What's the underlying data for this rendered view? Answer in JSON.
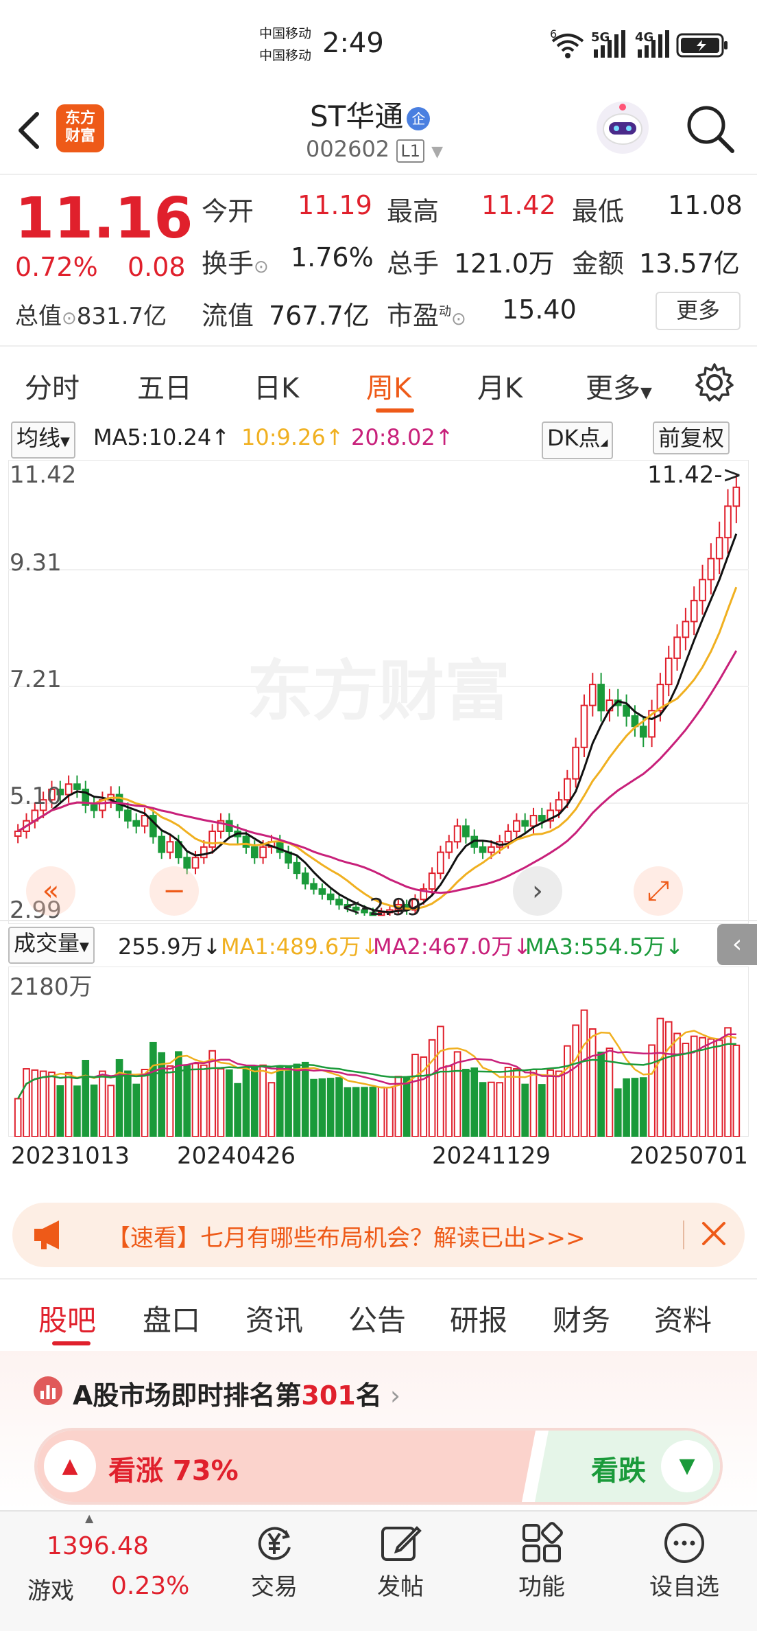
{
  "status_bar": {
    "carrier1": "中国移动",
    "carrier2": "中国移动",
    "time": "2:49",
    "net1": "6",
    "net2": "5G",
    "net3": "4G"
  },
  "header": {
    "logo_line1": "东方",
    "logo_line2": "财富",
    "title": "ST华通",
    "badge": "企",
    "code": "002602",
    "level": "L1"
  },
  "quote": {
    "price": "11.16",
    "change_pct": "0.72%",
    "change": "0.08",
    "total_value_label": "总值",
    "total_value": "831.7亿",
    "open_label": "今开",
    "open": "11.19",
    "high_label": "最高",
    "high": "11.42",
    "low_label": "最低",
    "low": "11.08",
    "turnover_label": "换手",
    "turnover": "1.76%",
    "volume_label": "总手",
    "volume": "121.0万",
    "amount_label": "金额",
    "amount": "13.57亿",
    "float_label": "流值",
    "float_value": "767.7亿",
    "pe_label": "市盈",
    "pe_sup": "动",
    "pe": "15.40",
    "more_label": "更多"
  },
  "tabs": {
    "items": [
      "分时",
      "五日",
      "日K",
      "周K",
      "月K",
      "更多"
    ],
    "active": "周K"
  },
  "kchart": {
    "ma_select": "均线",
    "ma5": "MA5:10.24↑",
    "ma10": "10:9.26↑",
    "ma20": "20:8.02↑",
    "dk_label": "DK点",
    "fq_label": "前复权",
    "y_labels": [
      "11.42",
      "9.31",
      "7.21",
      "5.10",
      "2.99"
    ],
    "max_marker": "11.42->",
    "min_marker": "<-2.99",
    "watermark": "东方财富",
    "vol_select": "成交量",
    "vol_current": "255.9万↓",
    "vol_ma1": "MA1:489.6万↓",
    "vol_ma2": "MA2:467.0万↓",
    "vol_ma3": "MA3:554.5万↓",
    "vol_top": "2180万",
    "dates": [
      "20231013",
      "20240426",
      "20241129",
      "20250701"
    ],
    "colors": {
      "up": "#e0202c",
      "down": "#1a9a3a",
      "ma5": "#111111",
      "ma10": "#f0b020",
      "ma20": "#c8207a"
    }
  },
  "chart_data": {
    "type": "candlestick",
    "x_range": [
      "20231013",
      "20250701"
    ],
    "ylim": [
      2.99,
      11.42
    ],
    "closes": [
      4.6,
      4.8,
      5.0,
      5.2,
      5.4,
      5.3,
      5.5,
      5.4,
      5.1,
      5.0,
      5.2,
      5.3,
      5.0,
      4.8,
      4.7,
      4.9,
      4.5,
      4.2,
      4.4,
      4.1,
      3.9,
      4.1,
      4.3,
      4.6,
      4.8,
      4.6,
      4.5,
      4.3,
      4.1,
      4.3,
      4.4,
      4.2,
      4.0,
      3.8,
      3.6,
      3.5,
      3.4,
      3.3,
      3.2,
      3.15,
      3.1,
      3.05,
      3.0,
      3.05,
      3.1,
      3.2,
      3.1,
      3.3,
      3.5,
      3.8,
      4.2,
      4.4,
      4.7,
      4.5,
      4.3,
      4.2,
      4.3,
      4.4,
      4.6,
      4.8,
      4.7,
      4.9,
      4.8,
      5.0,
      5.2,
      5.6,
      6.2,
      7.0,
      7.4,
      6.9,
      7.1,
      7.0,
      6.8,
      6.6,
      6.4,
      6.9,
      7.4,
      7.9,
      8.3,
      8.6,
      9.0,
      9.4,
      9.8,
      10.2,
      10.8,
      11.16
    ],
    "vol_ylim": [
      0,
      2180
    ]
  },
  "promo": {
    "text": "【速看】七月有哪些布局机会？解读已出>>>"
  },
  "subtabs": {
    "items": [
      "股吧",
      "盘口",
      "资讯",
      "公告",
      "研报",
      "财务",
      "资料"
    ],
    "active": "股吧"
  },
  "rank": {
    "prefix": "A股市场即时排名第",
    "number": "301",
    "suffix": "名",
    "bull_label": "看涨 73%",
    "bear_label": "看跌",
    "bull_pct": 73
  },
  "bottom_nav": {
    "index_value": "1396.48",
    "index_name": "游戏",
    "index_change": "0.23%",
    "items": [
      "交易",
      "发帖",
      "功能",
      "设自选"
    ]
  }
}
